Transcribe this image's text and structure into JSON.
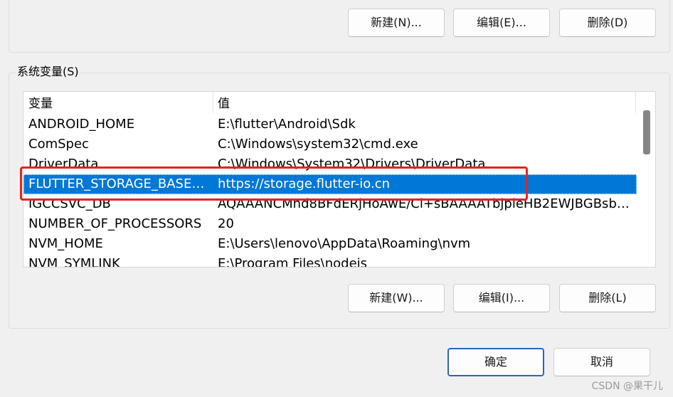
{
  "user_vars": {
    "new_label": "新建(N)...",
    "edit_label": "编辑(E)...",
    "delete_label": "删除(D)"
  },
  "system_vars": {
    "group_title": "系统变量(S)",
    "columns": {
      "variable": "变量",
      "value": "值"
    },
    "rows": [
      {
        "name": "ANDROID_HOME",
        "value": "E:\\flutter\\Android\\Sdk"
      },
      {
        "name": "ComSpec",
        "value": "C:\\Windows\\system32\\cmd.exe"
      },
      {
        "name": "DriverData",
        "value": "C:\\Windows\\System32\\Drivers\\DriverData"
      },
      {
        "name": "FLUTTER_STORAGE_BASE_U...",
        "value": "https://storage.flutter-io.cn"
      },
      {
        "name": "IGCCSVC_DB",
        "value": "AQAAANCMnd8BFdERjHoAwE/Cl+sBAAAATbjpieHB2EWJBGBsbL..."
      },
      {
        "name": "NUMBER_OF_PROCESSORS",
        "value": "20"
      },
      {
        "name": "NVM_HOME",
        "value": "E:\\Users\\lenovo\\AppData\\Roaming\\nvm"
      },
      {
        "name": "NVM_SYMLINK",
        "value": "E:\\Program Files\\nodejs"
      }
    ],
    "selected_row": "FLUTTER_STORAGE_BASE_U...",
    "new_label": "新建(W)...",
    "edit_label": "编辑(I)...",
    "delete_label": "删除(L)"
  },
  "dialog": {
    "ok_label": "确定",
    "cancel_label": "取消"
  },
  "watermark": "CSDN @果干儿",
  "colors": {
    "selection": "#0078d7",
    "highlight": "#e52222",
    "primary_border": "#2f63b8"
  }
}
